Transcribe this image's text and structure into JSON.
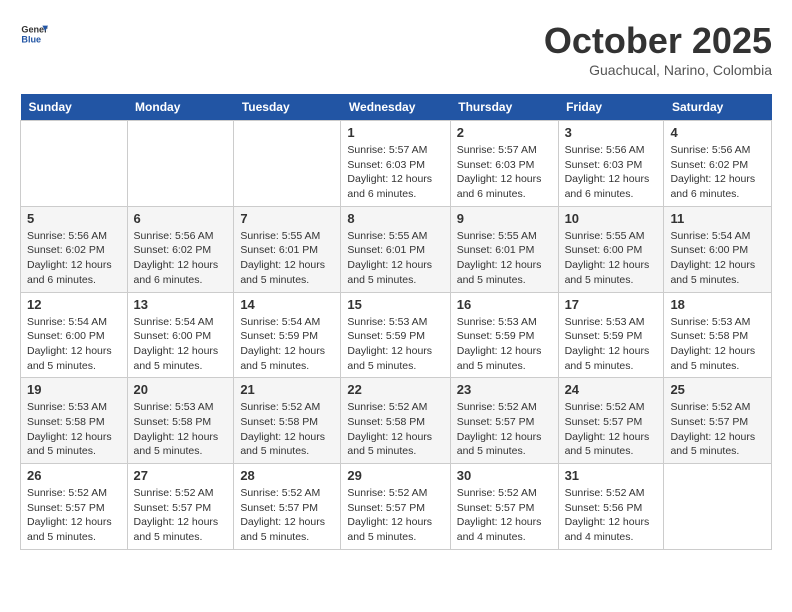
{
  "header": {
    "logo_line1": "General",
    "logo_line2": "Blue",
    "month": "October 2025",
    "location": "Guachucal, Narino, Colombia"
  },
  "weekdays": [
    "Sunday",
    "Monday",
    "Tuesday",
    "Wednesday",
    "Thursday",
    "Friday",
    "Saturday"
  ],
  "weeks": [
    [
      {
        "day": "",
        "info": ""
      },
      {
        "day": "",
        "info": ""
      },
      {
        "day": "",
        "info": ""
      },
      {
        "day": "1",
        "info": "Sunrise: 5:57 AM\nSunset: 6:03 PM\nDaylight: 12 hours and 6 minutes."
      },
      {
        "day": "2",
        "info": "Sunrise: 5:57 AM\nSunset: 6:03 PM\nDaylight: 12 hours and 6 minutes."
      },
      {
        "day": "3",
        "info": "Sunrise: 5:56 AM\nSunset: 6:03 PM\nDaylight: 12 hours and 6 minutes."
      },
      {
        "day": "4",
        "info": "Sunrise: 5:56 AM\nSunset: 6:02 PM\nDaylight: 12 hours and 6 minutes."
      }
    ],
    [
      {
        "day": "5",
        "info": "Sunrise: 5:56 AM\nSunset: 6:02 PM\nDaylight: 12 hours and 6 minutes."
      },
      {
        "day": "6",
        "info": "Sunrise: 5:56 AM\nSunset: 6:02 PM\nDaylight: 12 hours and 6 minutes."
      },
      {
        "day": "7",
        "info": "Sunrise: 5:55 AM\nSunset: 6:01 PM\nDaylight: 12 hours and 5 minutes."
      },
      {
        "day": "8",
        "info": "Sunrise: 5:55 AM\nSunset: 6:01 PM\nDaylight: 12 hours and 5 minutes."
      },
      {
        "day": "9",
        "info": "Sunrise: 5:55 AM\nSunset: 6:01 PM\nDaylight: 12 hours and 5 minutes."
      },
      {
        "day": "10",
        "info": "Sunrise: 5:55 AM\nSunset: 6:00 PM\nDaylight: 12 hours and 5 minutes."
      },
      {
        "day": "11",
        "info": "Sunrise: 5:54 AM\nSunset: 6:00 PM\nDaylight: 12 hours and 5 minutes."
      }
    ],
    [
      {
        "day": "12",
        "info": "Sunrise: 5:54 AM\nSunset: 6:00 PM\nDaylight: 12 hours and 5 minutes."
      },
      {
        "day": "13",
        "info": "Sunrise: 5:54 AM\nSunset: 6:00 PM\nDaylight: 12 hours and 5 minutes."
      },
      {
        "day": "14",
        "info": "Sunrise: 5:54 AM\nSunset: 5:59 PM\nDaylight: 12 hours and 5 minutes."
      },
      {
        "day": "15",
        "info": "Sunrise: 5:53 AM\nSunset: 5:59 PM\nDaylight: 12 hours and 5 minutes."
      },
      {
        "day": "16",
        "info": "Sunrise: 5:53 AM\nSunset: 5:59 PM\nDaylight: 12 hours and 5 minutes."
      },
      {
        "day": "17",
        "info": "Sunrise: 5:53 AM\nSunset: 5:59 PM\nDaylight: 12 hours and 5 minutes."
      },
      {
        "day": "18",
        "info": "Sunrise: 5:53 AM\nSunset: 5:58 PM\nDaylight: 12 hours and 5 minutes."
      }
    ],
    [
      {
        "day": "19",
        "info": "Sunrise: 5:53 AM\nSunset: 5:58 PM\nDaylight: 12 hours and 5 minutes."
      },
      {
        "day": "20",
        "info": "Sunrise: 5:53 AM\nSunset: 5:58 PM\nDaylight: 12 hours and 5 minutes."
      },
      {
        "day": "21",
        "info": "Sunrise: 5:52 AM\nSunset: 5:58 PM\nDaylight: 12 hours and 5 minutes."
      },
      {
        "day": "22",
        "info": "Sunrise: 5:52 AM\nSunset: 5:58 PM\nDaylight: 12 hours and 5 minutes."
      },
      {
        "day": "23",
        "info": "Sunrise: 5:52 AM\nSunset: 5:57 PM\nDaylight: 12 hours and 5 minutes."
      },
      {
        "day": "24",
        "info": "Sunrise: 5:52 AM\nSunset: 5:57 PM\nDaylight: 12 hours and 5 minutes."
      },
      {
        "day": "25",
        "info": "Sunrise: 5:52 AM\nSunset: 5:57 PM\nDaylight: 12 hours and 5 minutes."
      }
    ],
    [
      {
        "day": "26",
        "info": "Sunrise: 5:52 AM\nSunset: 5:57 PM\nDaylight: 12 hours and 5 minutes."
      },
      {
        "day": "27",
        "info": "Sunrise: 5:52 AM\nSunset: 5:57 PM\nDaylight: 12 hours and 5 minutes."
      },
      {
        "day": "28",
        "info": "Sunrise: 5:52 AM\nSunset: 5:57 PM\nDaylight: 12 hours and 5 minutes."
      },
      {
        "day": "29",
        "info": "Sunrise: 5:52 AM\nSunset: 5:57 PM\nDaylight: 12 hours and 5 minutes."
      },
      {
        "day": "30",
        "info": "Sunrise: 5:52 AM\nSunset: 5:57 PM\nDaylight: 12 hours and 4 minutes."
      },
      {
        "day": "31",
        "info": "Sunrise: 5:52 AM\nSunset: 5:56 PM\nDaylight: 12 hours and 4 minutes."
      },
      {
        "day": "",
        "info": ""
      }
    ]
  ]
}
